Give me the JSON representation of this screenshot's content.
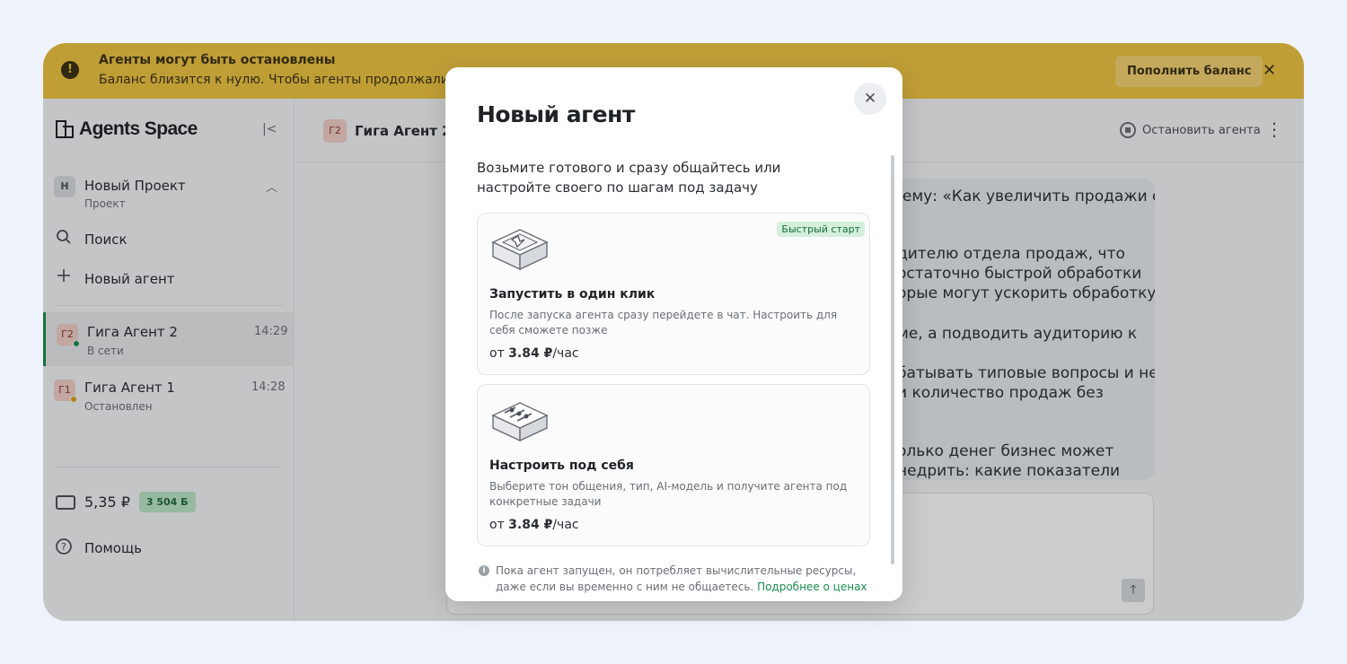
{
  "banner": {
    "title": "Агенты могут быть остановлены",
    "text": "Баланс близится к нулю. Чтобы агенты продолжали",
    "topup_label": "Пополнить баланс",
    "close_glyph": "✕",
    "warn_glyph": "!"
  },
  "sidebar": {
    "brand": "Agents Space",
    "collapse_glyph": "|<",
    "project": {
      "avatar": "Н",
      "title": "Новый Проект",
      "subtitle": "Проект",
      "chevron": "︿"
    },
    "search_label": "Поиск",
    "new_agent_label": "Новый агент",
    "agents": [
      {
        "avatar": "Г2",
        "name": "Гига Агент 2",
        "status": "В сети",
        "time": "14:29",
        "status_color": "#1a8f4b"
      },
      {
        "avatar": "Г1",
        "name": "Гига Агент 1",
        "status": "Остановлен",
        "time": "14:28",
        "status_color": "#e0a31a"
      }
    ],
    "balance": {
      "value": "5,35 ₽",
      "badge": "3 504 Б"
    },
    "help_label": "Помощь"
  },
  "main": {
    "agent_avatar": "Г2",
    "agent_name": "Гига Агент 2",
    "stop_label": "Остановить агента",
    "kebab": "⋮",
    "message_fragments": [
      "тему: «Как увеличить продажи с",
      "дителю отдела продаж, что",
      "остаточно быстрой обработки",
      "орые могут ускорить обработку",
      "ме, а подводить аудиторию к",
      "батывать типовые вопросы и не",
      "и количество продаж без",
      "олько денег бизнес может",
      "недрить: какие показатели"
    ],
    "send_glyph": "↑"
  },
  "modal": {
    "title": "Новый агент",
    "close_glyph": "✕",
    "intro": "Возьмите готового и сразу общайтесь или настройте своего по шагам под задачу",
    "cards": [
      {
        "tag": "Быстрый старт",
        "title": "Запустить в один клик",
        "desc": "После запуска агента сразу перейдете в чат. Настроить для себя сможете позже",
        "price_prefix": "от ",
        "price_value": "3.84 ₽",
        "price_unit": "/час",
        "icon": "quick-start-box-icon"
      },
      {
        "title": "Настроить под себя",
        "desc": "Выберите тон общения, тип, AI-модель и получите агента под конкретные задачи",
        "price_prefix": "от ",
        "price_value": "3.84 ₽",
        "price_unit": "/час",
        "icon": "settings-box-icon"
      }
    ],
    "note": "Пока агент запущен, он потребляет вычислительные ресурсы, даже если вы временно с ним не общаетесь. ",
    "note_link": "Подробнее о ценах",
    "info_glyph": "i"
  },
  "colors": {
    "banner": "#f0c43f",
    "accent_green": "#1a8f4b",
    "tag_bg": "#d4f0dc"
  }
}
